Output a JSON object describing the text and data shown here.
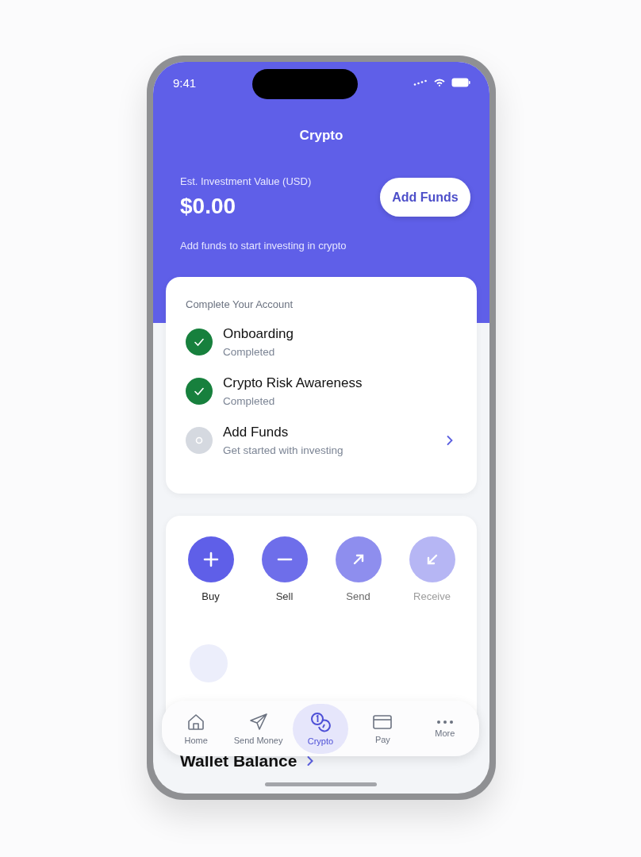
{
  "status_bar": {
    "time": "9:41"
  },
  "header": {
    "title": "Crypto",
    "value_label": "Est. Investment Value (USD)",
    "value": "$0.00",
    "add_funds_button": "Add Funds",
    "subtitle": "Add funds to start investing in crypto"
  },
  "checklist": {
    "title": "Complete Your Account",
    "items": [
      {
        "title": "Onboarding",
        "subtitle": "Completed",
        "completed": true
      },
      {
        "title": "Crypto Risk Awareness",
        "subtitle": "Completed",
        "completed": true
      },
      {
        "title": "Add Funds",
        "subtitle": "Get started with investing",
        "completed": false
      }
    ]
  },
  "actions": [
    {
      "kind": "buy",
      "label": "Buy"
    },
    {
      "kind": "sell",
      "label": "Sell"
    },
    {
      "kind": "send",
      "label": "Send"
    },
    {
      "kind": "receive",
      "label": "Receive"
    }
  ],
  "wallet_heading": "Wallet Balance",
  "tab_bar": [
    {
      "kind": "home",
      "label": "Home",
      "selected": false
    },
    {
      "kind": "send",
      "label": "Send Money",
      "selected": false
    },
    {
      "kind": "crypto",
      "label": "Crypto",
      "selected": true
    },
    {
      "kind": "pay",
      "label": "Pay",
      "selected": false
    },
    {
      "kind": "more",
      "label": "More",
      "selected": false
    }
  ]
}
